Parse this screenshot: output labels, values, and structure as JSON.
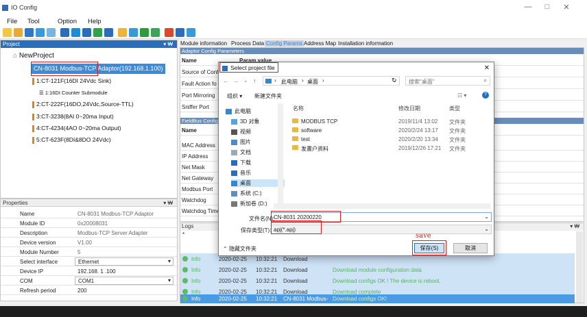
{
  "app": {
    "title": "IO Config"
  },
  "window_controls": {
    "minimize": "—",
    "maximize": "□",
    "close": "✕"
  },
  "menu": [
    "File",
    "Tool",
    "Option",
    "Help"
  ],
  "project_panel": {
    "header": "Project",
    "pin": "▾ ₩",
    "root": "NewProject",
    "adaptor": "CN-8031 Modbus-TCP Adaptor(192.168.1.100)",
    "modules": [
      "1:CT-121F(16DI 24Vdc Sink)",
      "1:16DI Counter Submodule",
      "2:CT-222F(16DO,24Vdc,Source-TTL)",
      "3:CT-3238(8AI 0~20ma Input)",
      "4:CT-4234(4AO 0~20ma Output)",
      "5:CT-623F(8DI&8DO 24Vdc)"
    ]
  },
  "properties": {
    "header": "Properties",
    "pin": "▾ ₩",
    "rows": [
      {
        "key": "Name",
        "value": "CN-8031 Modbus-TCP Adaptor"
      },
      {
        "key": "Module ID",
        "value": "0x20008031"
      },
      {
        "key": "Description",
        "value": "Modbus-TCP Server Adapter"
      },
      {
        "key": "Device version",
        "value": "V1.00"
      },
      {
        "key": "Module Number",
        "value": "5"
      },
      {
        "key": "Select interface",
        "value": "Ethernet"
      },
      {
        "key": "Device IP",
        "value": "192.168.  1  .100"
      },
      {
        "key": "COM",
        "value": "COM1"
      },
      {
        "key": "Refresh period",
        "value": "200"
      }
    ]
  },
  "tabs": [
    "Module information",
    "Process Data",
    "Config Params",
    "Address Map",
    "Installation information"
  ],
  "config": {
    "adaptor_section": "Adaptor Config Parameters",
    "col_name": "Name",
    "col_value": "Param value",
    "adaptor_rows": [
      "Source of Conf",
      "Fault Action fo",
      "Port Mirroring",
      "Sniffer Port"
    ],
    "fieldbus_section": "FieldBus Config",
    "fieldbus_rows": [
      "MAC Address",
      "IP Address",
      "Net Mask",
      "Net Gateway",
      "Modbus Port",
      "Watchdog",
      "Watchdog Time"
    ]
  },
  "logs": {
    "header": "Logs",
    "pin": "▾ ₩",
    "star": "*",
    "rows": [
      {
        "level": "Info",
        "date": "2020-02-25",
        "time": "10:32:21",
        "action": "Download",
        "msg": ""
      },
      {
        "level": "Info",
        "date": "2020-02-25",
        "time": "10:32:21",
        "action": "Download",
        "msg": "Download module  configuration data"
      },
      {
        "level": "Info",
        "date": "2020-02-25",
        "time": "10:32:21",
        "action": "Download",
        "msg": "Download configs OK ! The device is reboot."
      },
      {
        "level": "Info",
        "date": "2020-02-25",
        "time": "10:32:21",
        "action": "Download",
        "msg": "Download complete"
      },
      {
        "level": "Info",
        "date": "2020-02-25",
        "time": "10:32:21",
        "action": "CN-8031 Modbus-",
        "msg": "Download configs OK!"
      }
    ]
  },
  "dialog": {
    "title": "Select project file",
    "close": "✕",
    "path": [
      "此电脑",
      "桌面"
    ],
    "search_placeholder": "搜索\"桌面\"",
    "organize": "组织 ▾",
    "new_folder": "新建文件夹",
    "nav": [
      "此电脑",
      "3D 对象",
      "视频",
      "图片",
      "文档",
      "下载",
      "音乐",
      "桌面",
      "系统 (C:)",
      "新加卷 (D:)"
    ],
    "col_name": "名称",
    "col_date": "修改日期",
    "col_type": "类型",
    "files": [
      {
        "name": "MODBUS TCP",
        "date": "2019/11/4 13:02",
        "type": "文件夹"
      },
      {
        "name": "software",
        "date": "2020/2/24 13:17",
        "type": "文件夹"
      },
      {
        "name": "test",
        "date": "2020/2/20 13:34",
        "type": "文件夹"
      },
      {
        "name": "发書户资料",
        "date": "2019/12/26 17:21",
        "type": "文件夹"
      }
    ],
    "filename_label": "文件名(N):",
    "filename_value": "CN-8031 20200220",
    "filetype_label": "保存类型(T):",
    "filetype_value": "apj(*.apj)",
    "hide_folders": "隐藏文件夹",
    "save_button": "保存(S)",
    "cancel_button": "取消",
    "annotation": "save"
  }
}
